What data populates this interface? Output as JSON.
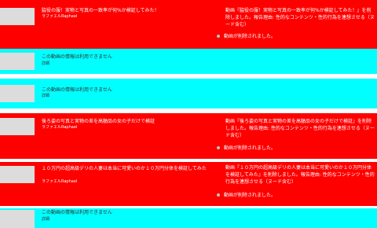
{
  "rows": [
    {
      "title": "脇役の服！実物と写真の一致率が何%か検証してみた！",
      "channel": "ラファエルRaphael",
      "notice": "動画『脇役の服！実物と写真の一致率が何%か検証してみた！』を削除しました。報告理由: 性的なコンテンツ・性的行為を連想させる（ヌード含む）",
      "removed": "動画が削除されました。"
    },
    {
      "title": "この動画の情報は利用できません",
      "detail": "詳細"
    },
    {
      "title": "この動画の情報は利用できません",
      "detail": "詳細"
    },
    {
      "title": "後ろ姿の写真と実物の差を高額品の女の子だけで検証",
      "channel": "ラファエルRaphael",
      "notice": "動画『後ろ姿の写真と実物の差を高額品の女の子だけで検証』を削除しました。報告理由: 性的なコンテンツ・性的行為を連想させる（ヌード含む）",
      "removed": "動画が削除されました。"
    },
    {
      "title": "１０万円の超高級デリの人妻は本当に可愛いのか１０万円分体を検証してみた",
      "channel": "ラファエルRaphael",
      "notice": "動画『１０万円の超高級デリの人妻は本当に可愛いのか１０万円分体を検証してみた』を削除しました。報告理由: 性的なコンテンツ・性的行為を連想させる（ヌード含む）",
      "removed": "動画が削除されました。"
    },
    {
      "title": "この動画の情報は利用できません",
      "detail": "詳細"
    }
  ]
}
